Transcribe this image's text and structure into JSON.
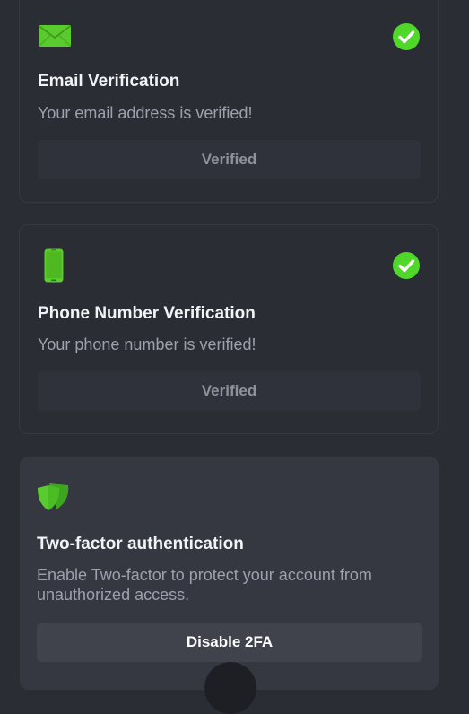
{
  "colors": {
    "background": "#2b2d35",
    "card_active": "#363841",
    "accent_green": "#58d32c",
    "check_green": "#4fd82a"
  },
  "email": {
    "icon": "envelope-icon",
    "title": "Email Verification",
    "description": "Your email address is verified!",
    "button_label": "Verified",
    "status_icon": "check-circle-icon"
  },
  "phone": {
    "icon": "smartphone-icon",
    "title": "Phone Number Verification",
    "description": "Your phone number is verified!",
    "button_label": "Verified",
    "status_icon": "check-circle-icon"
  },
  "two_factor": {
    "icon": "shield-icon",
    "title": "Two-factor authentication",
    "description": "Enable Two-factor to protect your account from unauthorized access.",
    "button_label": "Disable 2FA"
  }
}
